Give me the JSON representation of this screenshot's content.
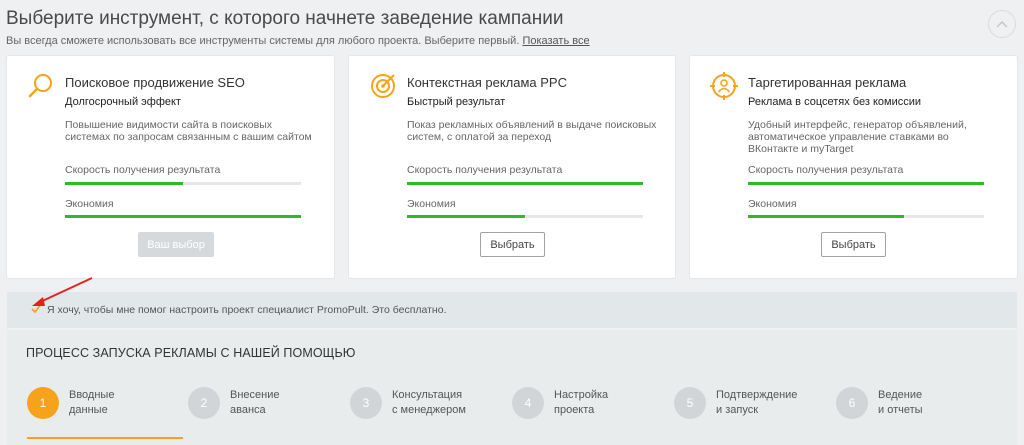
{
  "header": {
    "title": "Выберите инструмент, с которого начнете заведение кампании",
    "subtitle": "Вы всегда сможете использовать все инструменты системы для любого проекта. Выберите первый.",
    "show_all_link": "Показать все"
  },
  "cards": [
    {
      "icon": "search-icon",
      "title": "Поисковое продвижение SEO",
      "subtitle": "Долгосрочный эффект",
      "description": "Повышение видимости сайта в поисковых системах по запросам связанным с вашим сайтом",
      "metric1_label": "Скорость получения результата",
      "metric1_value": 0.5,
      "metric2_label": "Экономия",
      "metric2_value": 1.0,
      "button_label": "Ваш выбор",
      "button_state": "disabled"
    },
    {
      "icon": "target-icon",
      "title": "Контекстная реклама PPC",
      "subtitle": "Быстрый результат",
      "description": "Показ рекламных объявлений в выдаче поисковых систем, с оплатой за переход",
      "metric1_label": "Скорость получения результата",
      "metric1_value": 1.0,
      "metric2_label": "Экономия",
      "metric2_value": 0.5,
      "button_label": "Выбрать",
      "button_state": "enabled"
    },
    {
      "icon": "person-target-icon",
      "title": "Таргетированная реклама",
      "subtitle": "Реклама в соцсетях без комиссии",
      "description": "Удобный интерфейс, генератор объявлений, автоматическое управление ставками во ВКонтакте и myTarget",
      "metric1_label": "Скорость получения результата",
      "metric1_value": 1.0,
      "metric2_label": "Экономия",
      "metric2_value": 0.66,
      "button_label": "Выбрать",
      "button_state": "enabled"
    }
  ],
  "help": {
    "checkbox_checked": true,
    "text": "Я хочу, чтобы мне помог настроить проект специалист PromoPult. Это бесплатно."
  },
  "process": {
    "title": "ПРОЦЕСС ЗАПУСКА РЕКЛАМЫ С НАШЕЙ ПОМОЩЬЮ",
    "steps": [
      {
        "num": "1",
        "line1": "Вводные",
        "line2": "данные",
        "active": true
      },
      {
        "num": "2",
        "line1": "Внесение",
        "line2": "аванса",
        "active": false
      },
      {
        "num": "3",
        "line1": "Консультация",
        "line2": "с менеджером",
        "active": false
      },
      {
        "num": "4",
        "line1": "Настройка",
        "line2": "проекта",
        "active": false
      },
      {
        "num": "5",
        "line1": "Подтверждение",
        "line2": "и запуск",
        "active": false
      },
      {
        "num": "6",
        "line1": "Ведение",
        "line2": "и отчеты",
        "active": false
      }
    ]
  },
  "colors": {
    "accent": "#f7a21b",
    "progress": "#2db928",
    "annotation_arrow": "#e0231d"
  }
}
